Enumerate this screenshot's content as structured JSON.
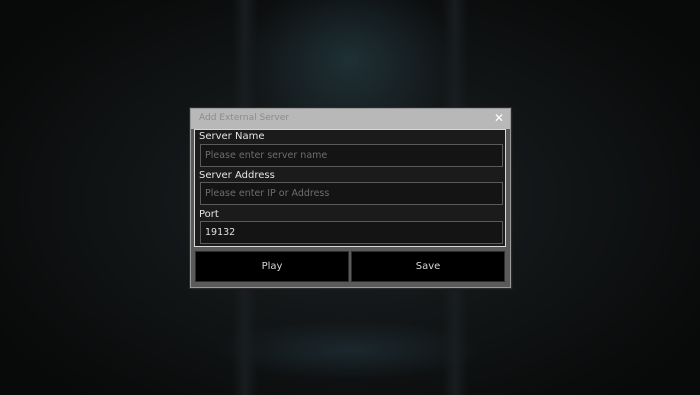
{
  "dialog": {
    "title": "Add External Server",
    "close_glyph": "✕"
  },
  "form": {
    "server_name": {
      "label": "Server Name",
      "placeholder": "Please enter server name",
      "value": ""
    },
    "server_address": {
      "label": "Server Address",
      "placeholder": "Please enter IP or Address",
      "value": ""
    },
    "port": {
      "label": "Port",
      "placeholder": "",
      "value": "19132"
    }
  },
  "buttons": {
    "play_label": "Play",
    "save_label": "Save"
  },
  "icons": {
    "close": "close-icon"
  },
  "colors": {
    "dialog_frame": "#5a5a5a",
    "titlebar": "#b8b8b8",
    "panel_bg": "#1b1b1b",
    "button_bg": "#000000"
  }
}
